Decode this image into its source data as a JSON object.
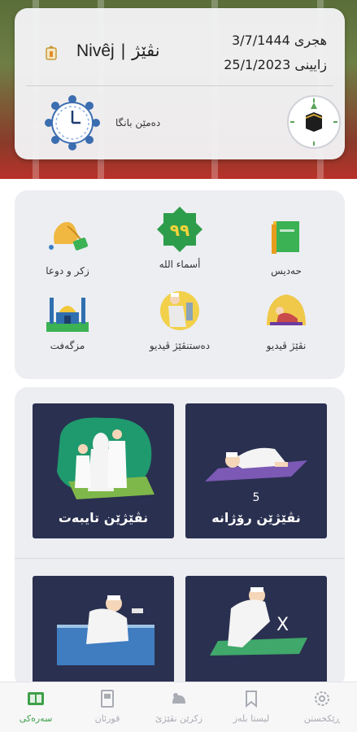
{
  "header": {
    "date_hijri": "هجری 3/7/1444",
    "date_gregorian": "زایینی 25/1/2023",
    "current_prayer_latin": "Nivêj",
    "current_prayer_separator": "|",
    "current_prayer_kurdish": "نڤێژ",
    "adhan_label": "دەمێن بانگا"
  },
  "features": [
    {
      "label": "حەدیس",
      "icon": "book-icon"
    },
    {
      "label": "أسماء الله",
      "icon": "ninety-nine-names-icon"
    },
    {
      "label": "زکر و دوعا",
      "icon": "prayer-beads-hands-icon"
    },
    {
      "label": "نڤێژ ڤیدیو",
      "icon": "prayer-video-icon"
    },
    {
      "label": "دەستنڤێژ ڤیدیو",
      "icon": "wudu-video-icon"
    },
    {
      "label": "مزگەفت",
      "icon": "mosque-icon"
    }
  ],
  "cards": [
    {
      "title": "نڤێژێن رۆژانە",
      "count": "5",
      "icon": "prostration-icon"
    },
    {
      "title": "نڤێژێن تایبەت",
      "icon": "family-prayer-icon"
    },
    {
      "title": "",
      "icon": "x-prayer-icon",
      "badge": "X"
    },
    {
      "title": "",
      "icon": "wudu-sink-icon"
    }
  ],
  "nav": [
    {
      "label": "ڕێکخستن",
      "icon": "settings-icon",
      "active": false
    },
    {
      "label": "لیستا بلەز",
      "icon": "bookmark-icon",
      "active": false
    },
    {
      "label": "زکرێن نڤێژێ",
      "icon": "prayer-beads-icon",
      "active": false
    },
    {
      "label": "قورئان",
      "icon": "quran-icon",
      "active": false
    },
    {
      "label": "سەرەکی",
      "icon": "home-icon",
      "active": true
    }
  ],
  "colors": {
    "card_bg": "#2a3050",
    "active_green": "#3ea04a",
    "panel_bg": "#eceef2"
  }
}
